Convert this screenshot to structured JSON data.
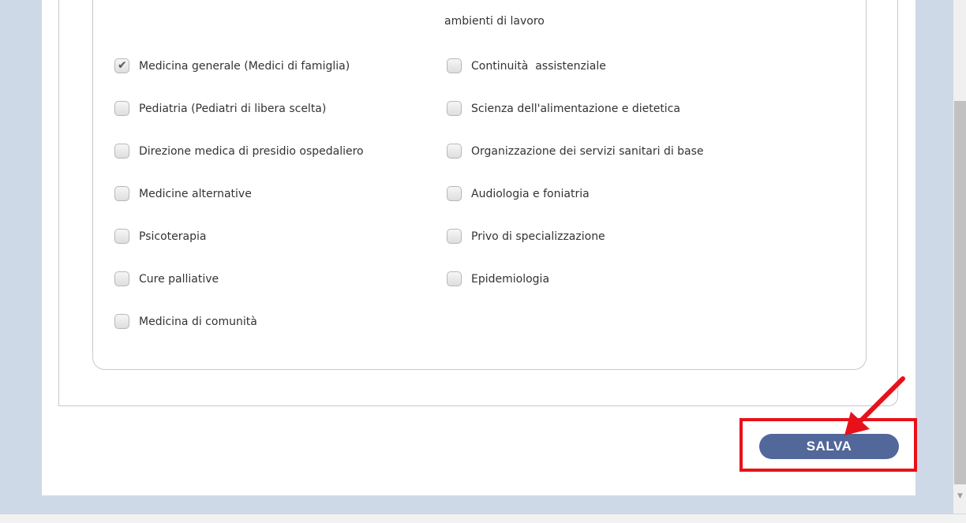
{
  "form": {
    "top_text": "ambienti di lavoro",
    "options_left": [
      {
        "label": "Medicina generale (Medici di famiglia)",
        "checked": true
      },
      {
        "label": "Pediatria (Pediatri di libera scelta)",
        "checked": false
      },
      {
        "label": "Direzione medica di presidio ospedaliero",
        "checked": false
      },
      {
        "label": "Medicine alternative",
        "checked": false
      },
      {
        "label": "Psicoterapia",
        "checked": false
      },
      {
        "label": "Cure palliative",
        "checked": false
      },
      {
        "label": "Medicina di comunità",
        "checked": false
      }
    ],
    "options_right": [
      {
        "label": "Continuità  assistenziale",
        "checked": false
      },
      {
        "label": "Scienza dell'alimentazione e dietetica",
        "checked": false
      },
      {
        "label": "Organizzazione dei servizi sanitari di base",
        "checked": false
      },
      {
        "label": "Audiologia e foniatria",
        "checked": false
      },
      {
        "label": "Privo di specializzazione",
        "checked": false
      },
      {
        "label": "Epidemiologia",
        "checked": false
      }
    ]
  },
  "actions": {
    "save_label": "SALVA"
  },
  "annotation": {
    "color": "#e8111a"
  },
  "colors": {
    "side_panel": "#ced9e8",
    "button": "#52679a"
  }
}
